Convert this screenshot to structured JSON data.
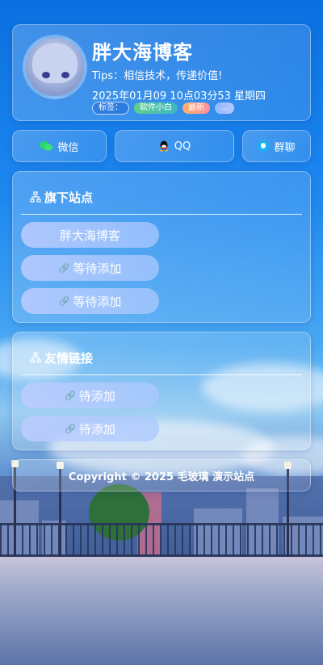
{
  "profile": {
    "site_name": "胖大海博客",
    "tips": "Tips：相信技术，传递价值!",
    "datetime": "2025年01月09 10点03分53 星期四",
    "tag_label": "标签：",
    "tags": [
      "软件小白",
      "最新",
      "…"
    ]
  },
  "contacts": {
    "wechat": "微信",
    "qq": "QQ",
    "group": "群聊"
  },
  "sites": {
    "title": "旗下站点",
    "items": [
      "胖大海博客",
      "等待添加",
      "等待添加"
    ]
  },
  "friends": {
    "title": "友情链接",
    "items": [
      "待添加",
      "待添加"
    ]
  },
  "footer": {
    "text": "Copyright © 2025 毛玻璃 演示站点"
  },
  "colors": {
    "accent": "#1e88f0",
    "wechat_green": "#2bd46a",
    "qq_black": "#111111",
    "group_blue": "#16b3f5"
  },
  "icons": {
    "wechat": "wechat-icon",
    "qq": "qq-icon",
    "group": "group-chat-icon",
    "section": "sitemap-icon",
    "link": "link-icon"
  }
}
